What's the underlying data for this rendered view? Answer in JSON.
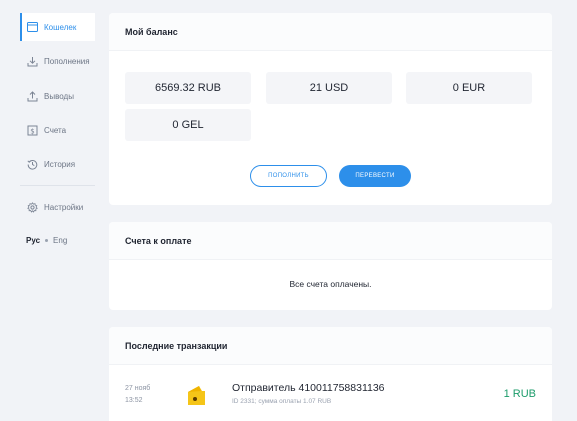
{
  "sidebar": {
    "items": [
      {
        "label": "Кошелек",
        "icon": "wallet-icon",
        "active": true
      },
      {
        "label": "Пополнения",
        "icon": "download-icon"
      },
      {
        "label": "Выводы",
        "icon": "upload-icon"
      },
      {
        "label": "Счета",
        "icon": "invoice-icon"
      },
      {
        "label": "История",
        "icon": "history-icon"
      },
      {
        "label": "Настройки",
        "icon": "gear-icon"
      }
    ],
    "lang": {
      "current": "Рус",
      "other": "Eng"
    }
  },
  "balance": {
    "title": "Мой баланс",
    "items": [
      "6569.32 RUB",
      "21 USD",
      "0 EUR",
      "0 GEL"
    ],
    "topup_label": "ПОПОЛНИТЬ",
    "transfer_label": "ПЕРЕВЕСТИ"
  },
  "invoices": {
    "title": "Счета к оплате",
    "empty_message": "Все счета оплачены."
  },
  "transactions": {
    "title": "Последние транзакции",
    "items": [
      {
        "date": "27 нояб",
        "time": "13:52",
        "title": "Отправитель 410011758831136",
        "subtitle": "ID 2331; сумма оплаты 1.07 RUB",
        "amount": "1 RUB"
      }
    ]
  },
  "colors": {
    "accent": "#2d8fea",
    "positive": "#1b9b6a",
    "yoomoney": "#f5c518"
  }
}
